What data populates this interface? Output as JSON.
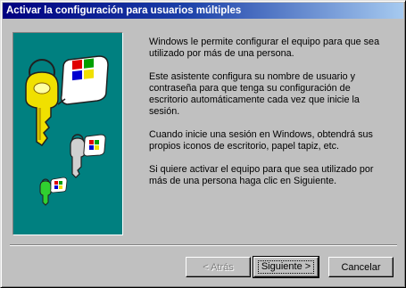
{
  "window": {
    "title": "Activar la configuración para usuarios múltiples",
    "colors": {
      "title_start": "#000080",
      "title_end": "#a6caf0",
      "panel": "#008080",
      "face": "#c0c0c0"
    }
  },
  "illustration": {
    "icons": [
      "large-yellow-key-icon",
      "windows-logo-tag-icon",
      "gray-key-icon",
      "green-key-icon"
    ]
  },
  "content": {
    "paragraphs": [
      "Windows le permite configurar el equipo para que sea utilizado por más de una persona.",
      "Este asistente configura su nombre de usuario y contraseña para que tenga su configuración de escritorio automáticamente cada vez que inicie la sesión.",
      "Cuando inicie una sesión en Windows, obtendrá sus propios iconos de escritorio, papel tapiz, etc.",
      "Si quiere activar el equipo para que sea utilizado por más de una persona haga clic en Siguiente."
    ]
  },
  "buttons": {
    "back": "< Atrás",
    "next": "Siguiente >",
    "cancel": "Cancelar"
  }
}
